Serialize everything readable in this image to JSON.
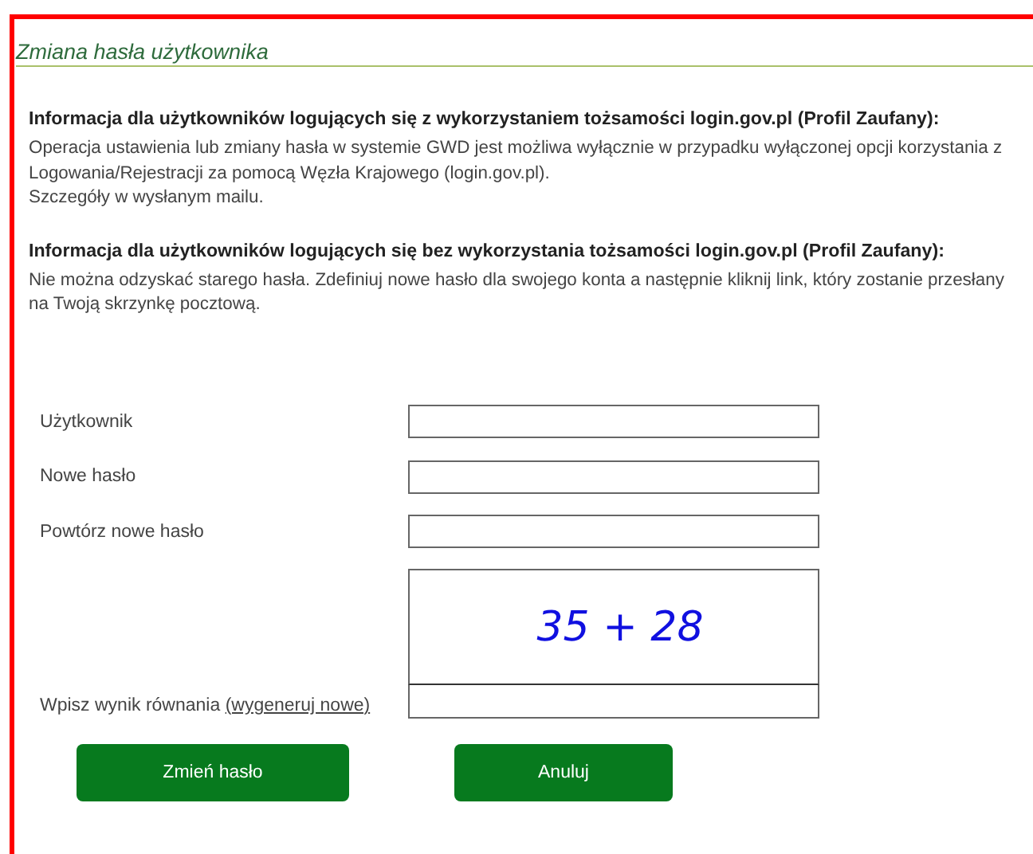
{
  "panel": {
    "title": "Zmiana hasła użytkownika"
  },
  "info_sections": [
    {
      "heading": "Informacja dla użytkowników logujących się z wykorzystaniem tożsamości login.gov.pl (Profil Zaufany):",
      "lines": [
        "Operacja ustawienia lub zmiany hasła w systemie GWD jest możliwa wyłącznie w przypadku wyłączonej opcji korzystania z Logowania/Rejestracji za pomocą Węzła Krajowego (login.gov.pl).",
        "Szczegóły w wysłanym mailu."
      ]
    },
    {
      "heading": "Informacja dla użytkowników logujących się bez wykorzystania tożsamości login.gov.pl (Profil Zaufany):",
      "lines": [
        "Nie można odzyskać starego hasła. Zdefiniuj nowe hasło dla swojego konta a następnie kliknij link, który zostanie przesłany na Twoją skrzynkę pocztową."
      ]
    }
  ],
  "fields": [
    {
      "label": "Użytkownik"
    },
    {
      "label": "Nowe hasło"
    },
    {
      "label": "Powtórz nowe hasło"
    }
  ],
  "captcha": {
    "equation": "35 + 28",
    "label": "Wpisz wynik równania",
    "link": "(wygeneruj nowe)"
  },
  "buttons": [
    "Zmień hasło",
    "Anuluj"
  ]
}
